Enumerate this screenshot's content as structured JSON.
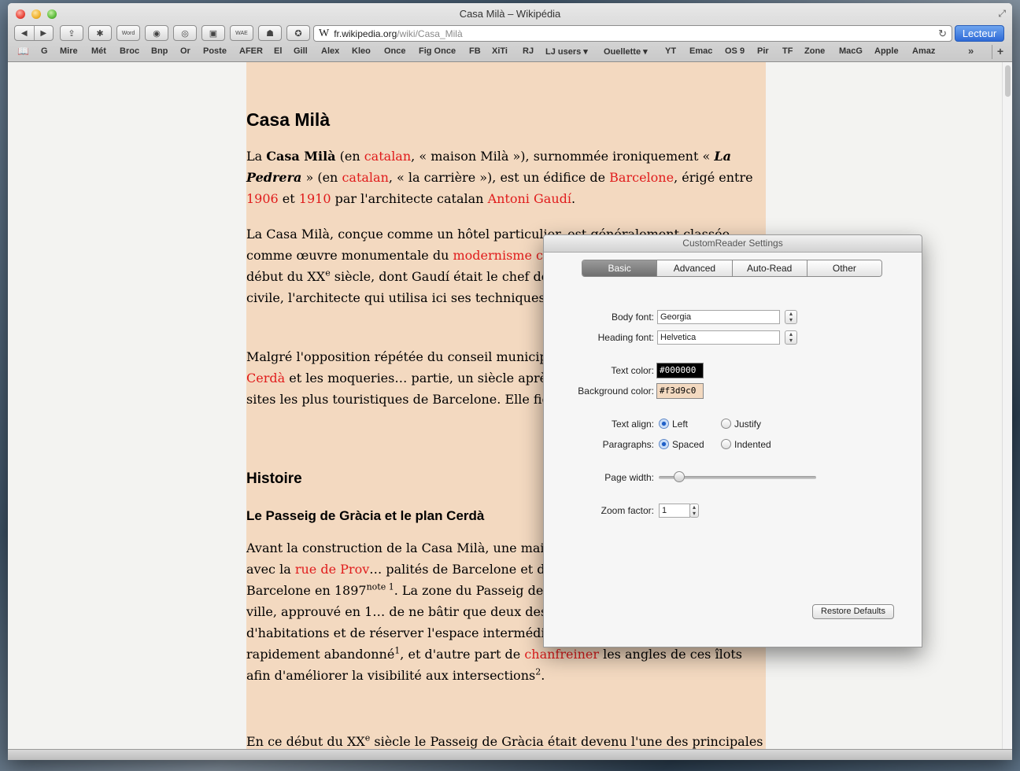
{
  "window": {
    "title": "Casa Milà – Wikipédia"
  },
  "toolbar": {
    "back_icon": "back-arrow-icon",
    "forward_icon": "forward-arrow-icon",
    "address_prefix": "W",
    "address_host": "fr.wikipedia.org",
    "address_path": "/wiki/Casa_Milà",
    "reader_label": "Lecteur"
  },
  "bookmarks": [
    "G",
    "Mire",
    "Mét",
    "Broc",
    "Bnp",
    "Or",
    "Poste",
    "AFER",
    "El",
    "Gill",
    "Alex",
    "Kleo",
    "Once",
    "Fig Once",
    "FB",
    "XiTi",
    "RJ",
    "LJ users ▾",
    "Ouellette ▾",
    "YT",
    "Emac",
    "OS 9",
    "Pir",
    "TF",
    "Zone",
    "MacG",
    "Apple",
    "Amaz"
  ],
  "article": {
    "title": "Casa Milà",
    "h_histoire": "Histoire",
    "h_passeig": "Le Passeig de Gràcia et le plan Cerdà"
  },
  "dialog": {
    "title": "CustomReader Settings",
    "tabs": [
      "Basic",
      "Advanced",
      "Auto-Read",
      "Other"
    ],
    "body_font_label": "Body font:",
    "body_font_value": "Georgia",
    "heading_font_label": "Heading font:",
    "heading_font_value": "Helvetica",
    "text_color_label": "Text color:",
    "text_color_value": "#000000",
    "bg_color_label": "Background color:",
    "bg_color_value": "#f3d9c0",
    "text_align_label": "Text align:",
    "align_left": "Left",
    "align_justify": "Justify",
    "paragraphs_label": "Paragraphs:",
    "para_spaced": "Spaced",
    "para_indented": "Indented",
    "page_width_label": "Page width:",
    "page_width_fraction": 0.1,
    "zoom_label": "Zoom factor:",
    "zoom_value": "1",
    "restore_label": "Restore Defaults"
  }
}
